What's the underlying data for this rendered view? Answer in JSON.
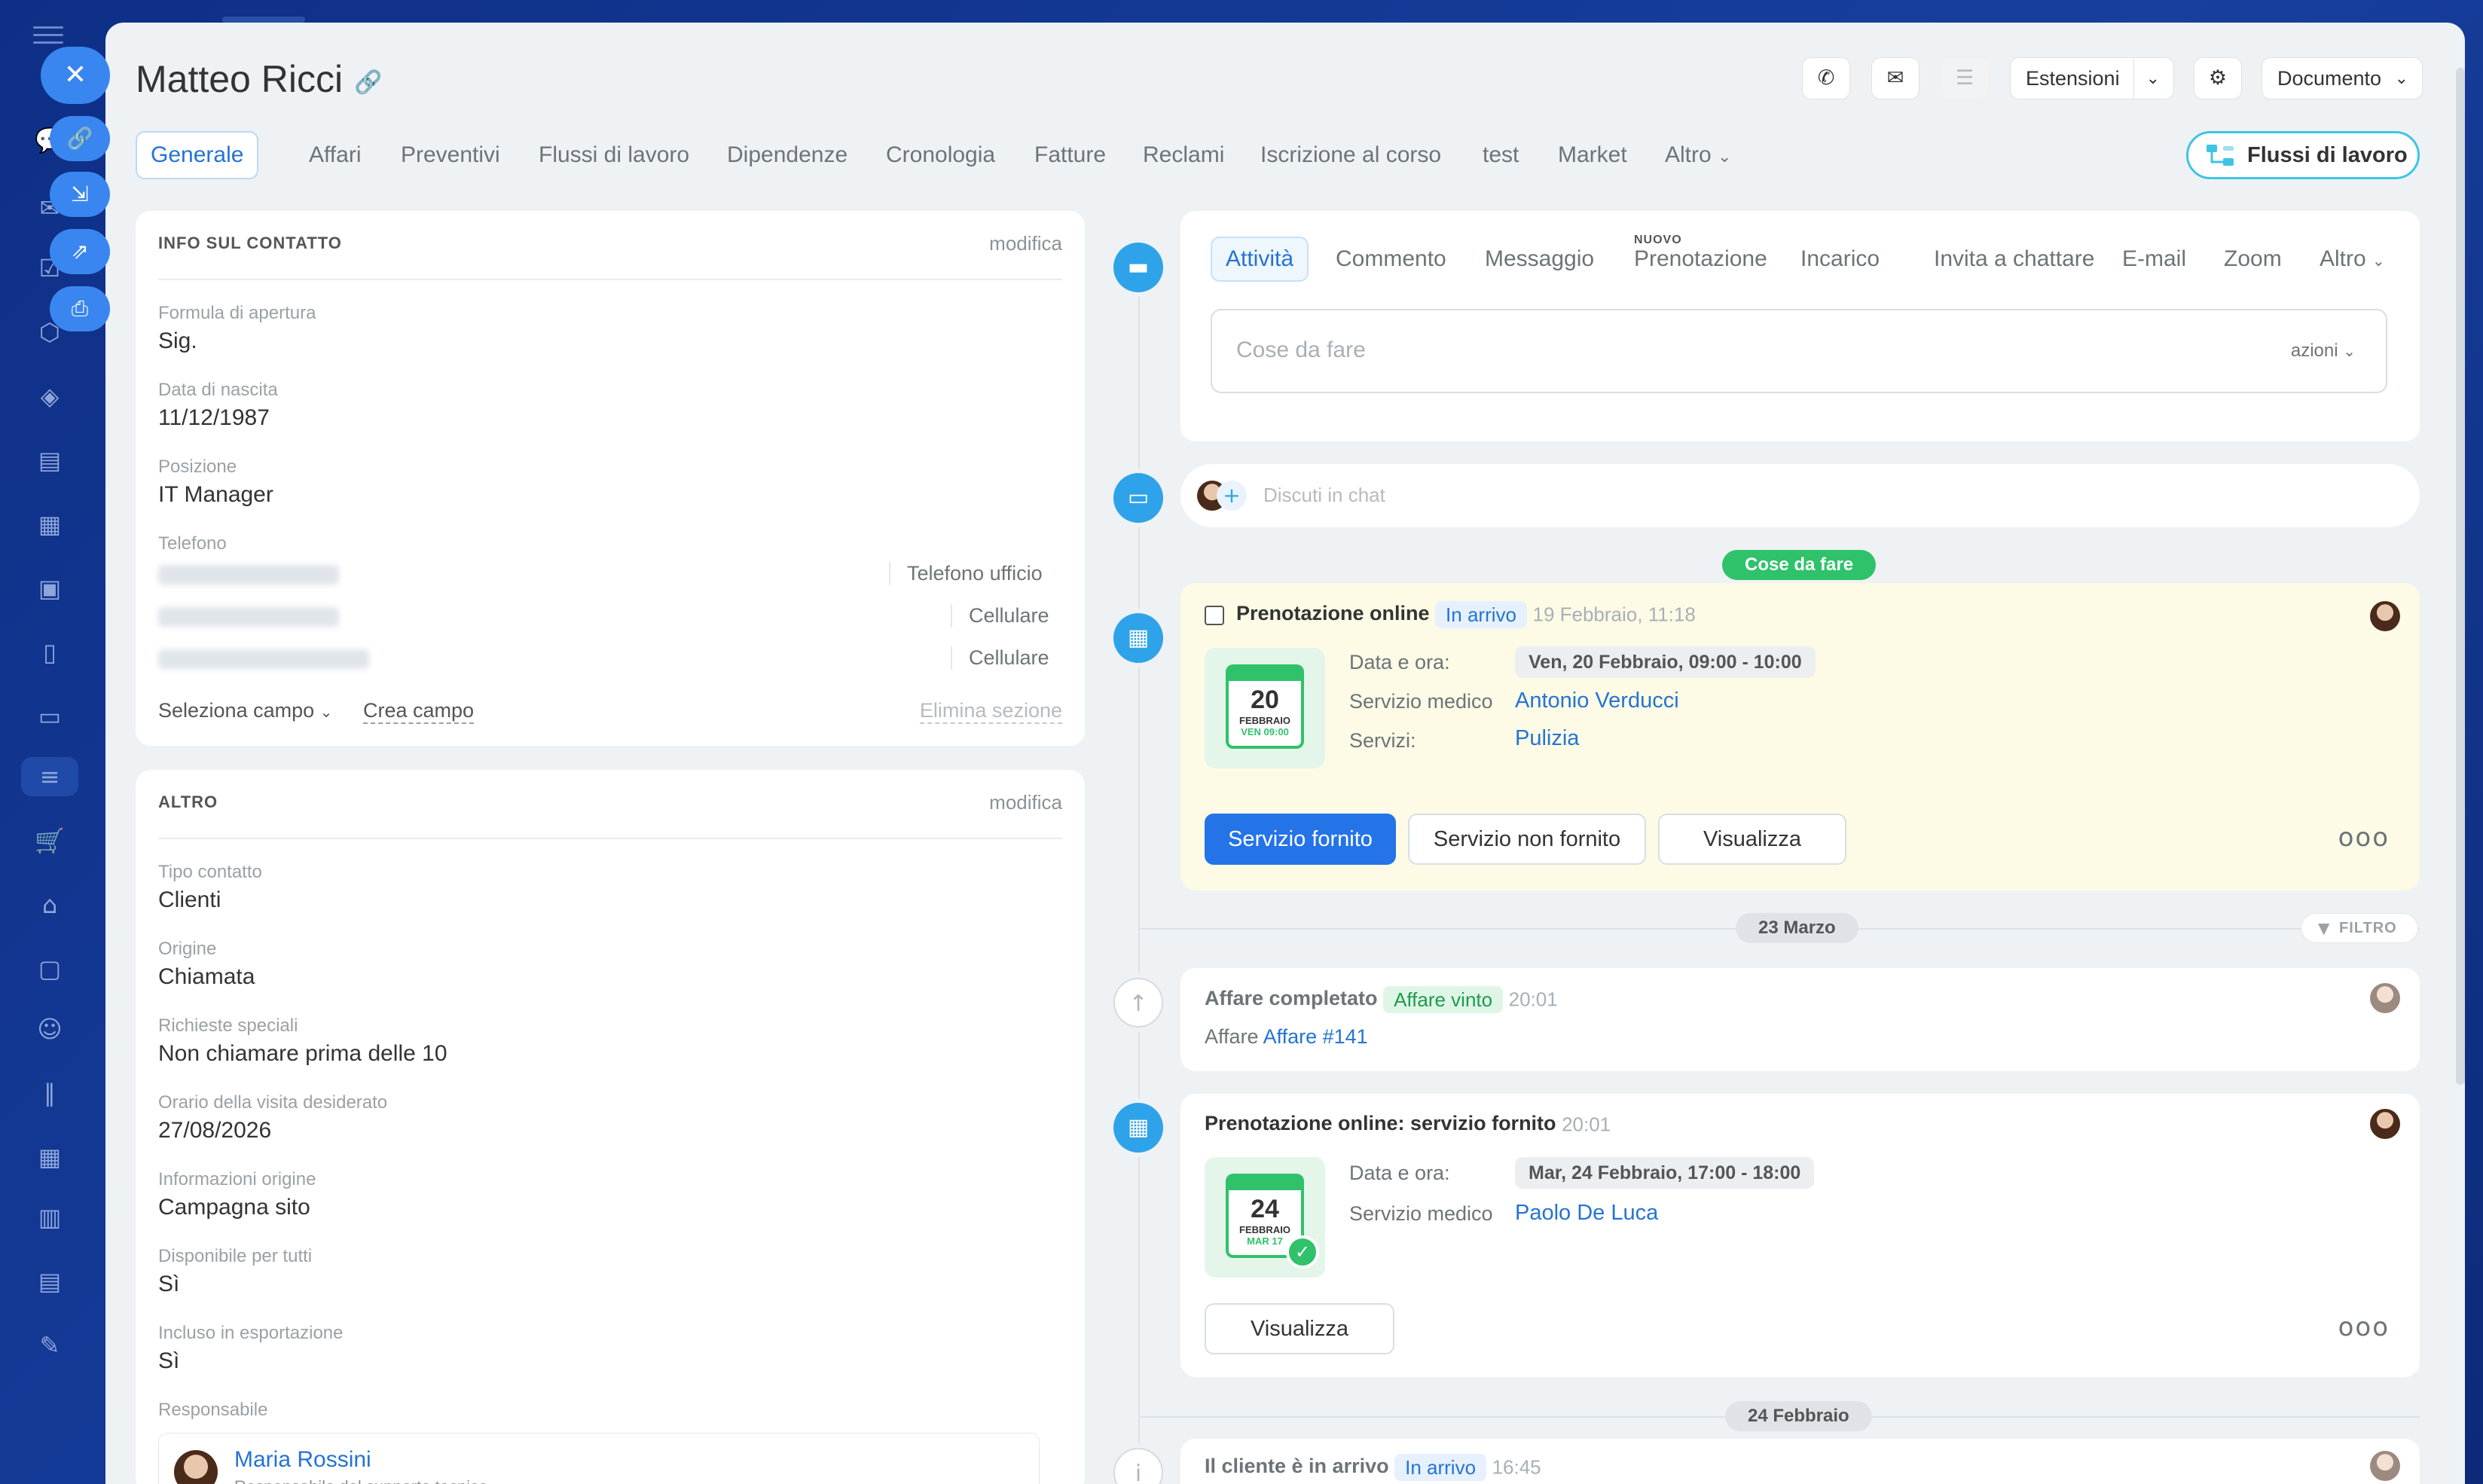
{
  "header": {
    "title": "Matteo Ricci",
    "estensioni": "Estensioni",
    "documento": "Documento"
  },
  "tabs": [
    "Generale",
    "Affari",
    "Preventivi",
    "Flussi di lavoro",
    "Dipendenze",
    "Cronologia",
    "Fatture",
    "Reclami",
    "Iscrizione al corso",
    "test",
    "Market",
    "Altro"
  ],
  "flussi_btn": "Flussi di lavoro",
  "contact": {
    "section": "INFO SUL CONTATTO",
    "edit": "modifica",
    "fields": [
      {
        "label": "Formula di apertura",
        "value": "Sig."
      },
      {
        "label": "Data di nascita",
        "value": "11/12/1987"
      },
      {
        "label": "Posizione",
        "value": "IT Manager"
      }
    ],
    "phone_label": "Telefono",
    "phone_types": [
      "Telefono ufficio",
      "Cellulare",
      "Cellulare"
    ],
    "select_field": "Seleziona campo",
    "create_field": "Crea campo",
    "delete_section": "Elimina sezione"
  },
  "altro": {
    "section": "ALTRO",
    "edit": "modifica",
    "fields": [
      {
        "label": "Tipo contatto",
        "value": "Clienti"
      },
      {
        "label": "Origine",
        "value": "Chiamata"
      },
      {
        "label": "Richieste speciali",
        "value": "Non chiamare prima delle 10"
      },
      {
        "label": "Orario della visita desiderato",
        "value": "27/08/2026"
      },
      {
        "label": "Informazioni origine",
        "value": "Campagna sito"
      },
      {
        "label": "Disponibile per tutti",
        "value": "Sì"
      },
      {
        "label": "Incluso in esportazione",
        "value": "Sì"
      }
    ],
    "responsabile_label": "Responsabile",
    "responsabile_name": "Maria Rossini",
    "responsabile_role": "Responsabile del supporto tecnico"
  },
  "activity": {
    "tabs": [
      "Attività",
      "Commento",
      "Messaggio",
      "Prenotazione",
      "Incarico",
      "Invita a chattare",
      "E-mail",
      "Zoom",
      "Altro"
    ],
    "nuovo": "NUOVO",
    "todo_placeholder": "Cose da fare",
    "azioni": "azioni",
    "chat_placeholder": "Discuti in chat"
  },
  "timeline": {
    "pill_todo": "Cose da fare",
    "booking1": {
      "title": "Prenotazione online",
      "badge": "In arrivo",
      "time": "19 Febbraio, 11:18",
      "k1": "Data e ora:",
      "v1": "Ven, 20 Febbraio, 09:00 - 10:00",
      "k2": "Servizio medico",
      "v2": "Antonio Verducci",
      "k3": "Servizi:",
      "v3": "Pulizia",
      "cal_day": "20",
      "cal_month": "FEBBRAIO",
      "cal_time": "VEN 09:00",
      "btn1": "Servizio fornito",
      "btn2": "Servizio non fornito",
      "btn3": "Visualizza"
    },
    "date1": "23 Marzo",
    "filtro": "FILTRO",
    "deal": {
      "title": "Affare completato",
      "badge": "Affare vinto",
      "time": "20:01",
      "label": "Affare",
      "link": "Affare #141"
    },
    "booking2": {
      "title": "Prenotazione online: servizio fornito",
      "time": "20:01",
      "k1": "Data e ora:",
      "v1": "Mar, 24 Febbraio, 17:00 - 18:00",
      "k2": "Servizio medico",
      "v2": "Paolo De Luca",
      "cal_day": "24",
      "cal_month": "FEBBRAIO",
      "cal_time": "MAR 17",
      "btn": "Visualizza"
    },
    "date2": "24 Febbraio",
    "arrival": {
      "title": "Il cliente è in arrivo",
      "badge": "In arrivo",
      "time": "16:45"
    }
  },
  "colors": {
    "accent": "#2474e8",
    "green": "#2fc26b",
    "booking_bg": "#fdfbe6",
    "sidebar": "#123a94"
  }
}
